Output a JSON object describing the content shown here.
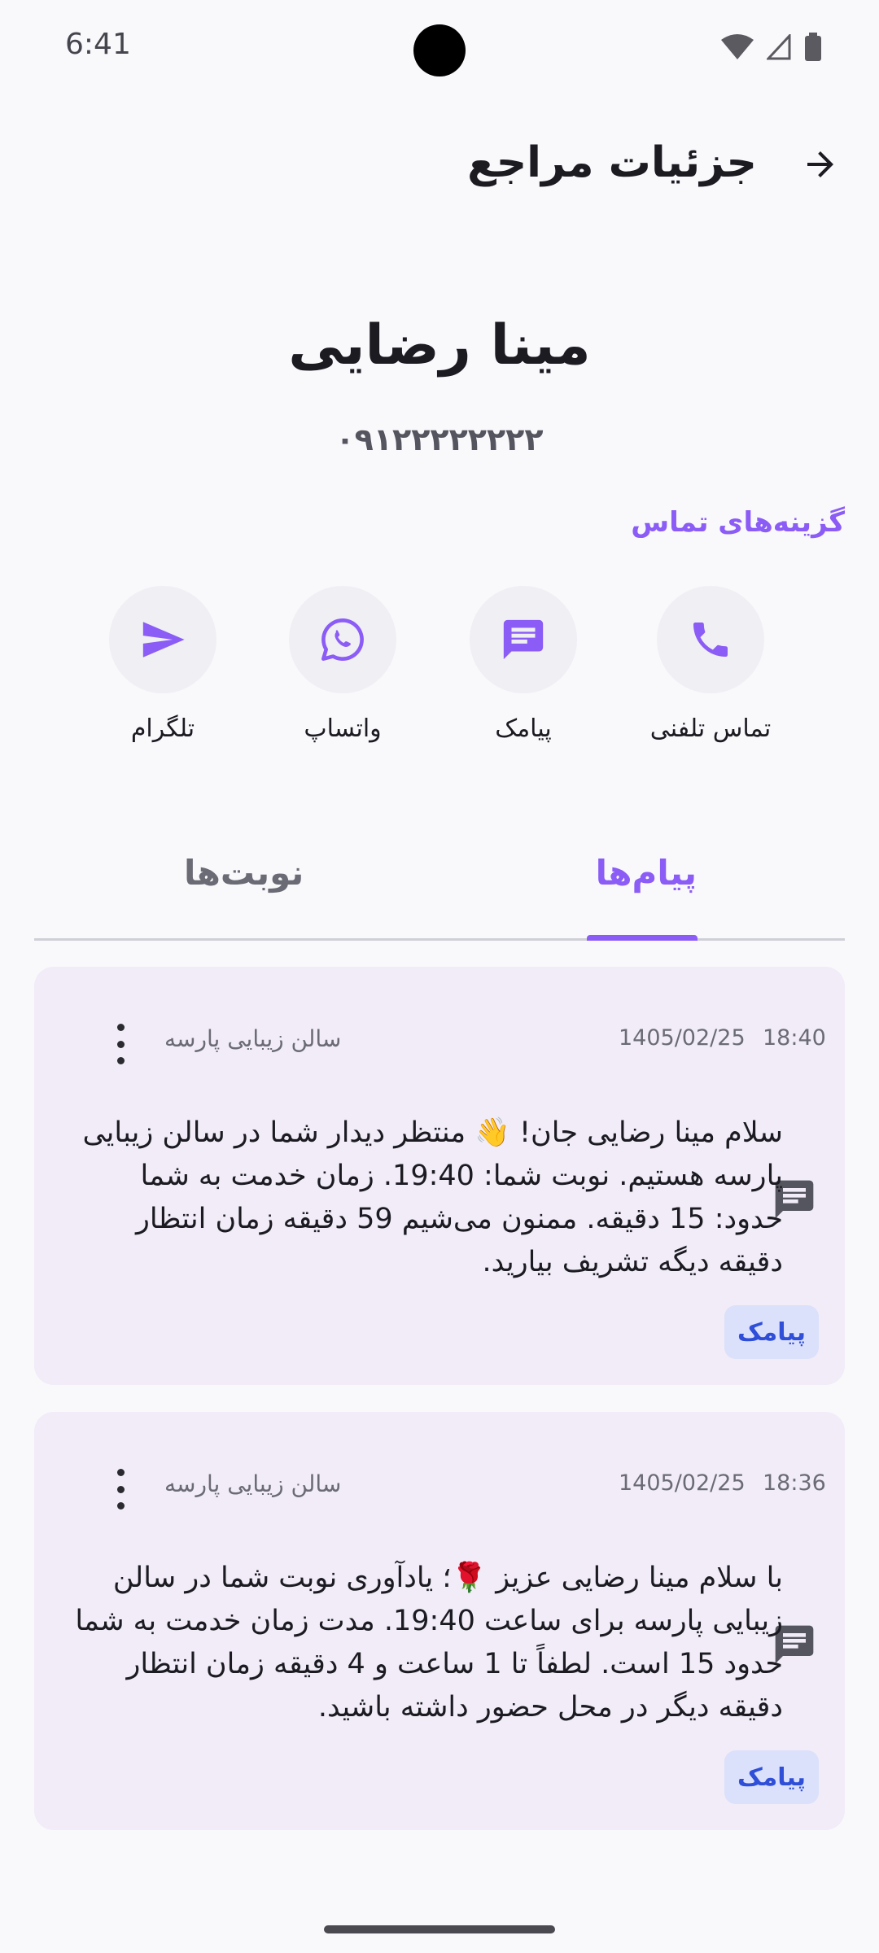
{
  "status_bar": {
    "time": "6:41"
  },
  "header": {
    "title": "جزئیات مراجع"
  },
  "client": {
    "name": "مینا رضایی",
    "phone": "۰۹۱۲۲۲۲۲۲۲۲"
  },
  "contact_section": {
    "title": "گزینه‌های تماس",
    "options": [
      {
        "label": "تماس تلفنی",
        "icon": "phone-icon"
      },
      {
        "label": "پیامک",
        "icon": "sms-icon"
      },
      {
        "label": "واتساپ",
        "icon": "whatsapp-icon"
      },
      {
        "label": "تلگرام",
        "icon": "telegram-icon"
      }
    ]
  },
  "tabs": [
    {
      "label": "پیام‌ها",
      "active": true
    },
    {
      "label": "نوبت‌ها",
      "active": false
    }
  ],
  "messages": [
    {
      "time": "18:40",
      "date": "1405/02/25",
      "sender": "سالن زیبایی پارسه",
      "body": "سلام مینا رضایی جان! 👋 منتظر دیدار شما در سالن زیبایی پارسه هستیم. نوبت شما: 19:40. زمان خدمت به شما حدود: 15 دقیقه. ممنون می‌شیم 59 دقیقه زمان انتظار دقیقه دیگه تشریف بیارید.",
      "badge": "پیامک"
    },
    {
      "time": "18:36",
      "date": "1405/02/25",
      "sender": "سالن زیبایی پارسه",
      "body": "با سلام مینا رضایی عزیز 🌹؛ یادآوری نوبت شما در سالن زیبایی پارسه برای ساعت 19:40. مدت زمان خدمت به شما حدود 15 است. لطفاً تا 1 ساعت و 4 دقیقه زمان انتظار دقیقه دیگر در محل حضور داشته باشید.",
      "badge": "پیامک"
    }
  ],
  "colors": {
    "accent": "#8b5cf6",
    "card_bg": "#f1ecf8",
    "badge_bg": "#dbe0fb",
    "badge_text": "#2f4fd8"
  }
}
